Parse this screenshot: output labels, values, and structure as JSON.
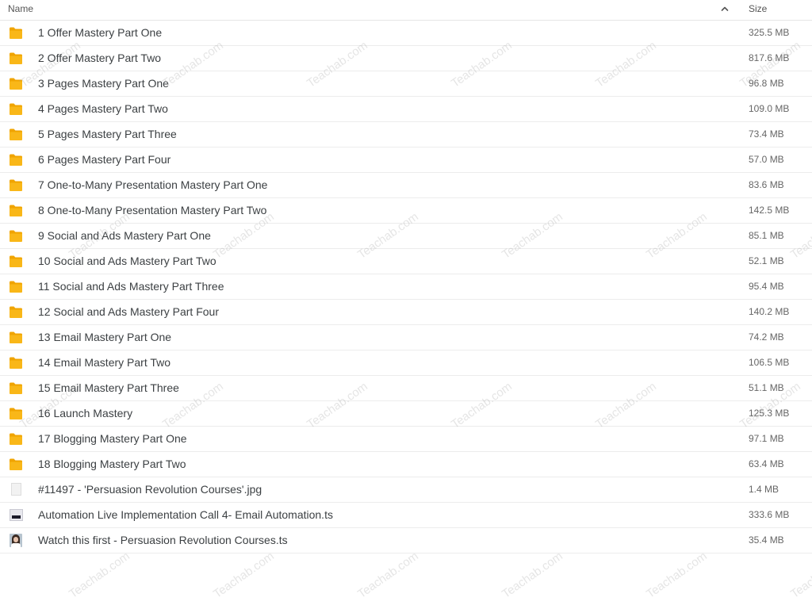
{
  "header": {
    "name_label": "Name",
    "size_label": "Size",
    "sort_icon": "chevron-up-icon"
  },
  "colors": {
    "folder": "#f9b718",
    "folder_dark": "#f0a400",
    "row_border": "#ececec"
  },
  "watermark_text": "Teachab.com",
  "files": [
    {
      "type": "folder",
      "name": "1 Offer Mastery Part One",
      "size": "325.5 MB"
    },
    {
      "type": "folder",
      "name": "2 Offer Mastery Part Two",
      "size": "817.6 MB"
    },
    {
      "type": "folder",
      "name": "3 Pages Mastery Part One",
      "size": "96.8 MB"
    },
    {
      "type": "folder",
      "name": "4 Pages Mastery Part Two",
      "size": "109.0 MB"
    },
    {
      "type": "folder",
      "name": "5 Pages Mastery Part Three",
      "size": "73.4 MB"
    },
    {
      "type": "folder",
      "name": "6 Pages Mastery Part Four",
      "size": "57.0 MB"
    },
    {
      "type": "folder",
      "name": "7 One-to-Many Presentation Mastery Part One",
      "size": "83.6 MB"
    },
    {
      "type": "folder",
      "name": "8 One-to-Many Presentation Mastery Part Two",
      "size": "142.5 MB"
    },
    {
      "type": "folder",
      "name": "9 Social and Ads Mastery Part One",
      "size": "85.1 MB"
    },
    {
      "type": "folder",
      "name": "10 Social and Ads Mastery Part Two",
      "size": "52.1 MB"
    },
    {
      "type": "folder",
      "name": "11 Social and Ads Mastery Part Three",
      "size": "95.4 MB"
    },
    {
      "type": "folder",
      "name": "12 Social and Ads Mastery Part Four",
      "size": "140.2 MB"
    },
    {
      "type": "folder",
      "name": "13 Email Mastery Part One",
      "size": "74.2 MB"
    },
    {
      "type": "folder",
      "name": "14 Email Mastery Part Two",
      "size": "106.5 MB"
    },
    {
      "type": "folder",
      "name": "15 Email Mastery Part Three",
      "size": "51.1 MB"
    },
    {
      "type": "folder",
      "name": "16 Launch Mastery",
      "size": "125.3 MB"
    },
    {
      "type": "folder",
      "name": "17 Blogging Mastery Part One",
      "size": "97.1 MB"
    },
    {
      "type": "folder",
      "name": "18 Blogging Mastery Part Two",
      "size": "63.4 MB"
    },
    {
      "type": "image",
      "name": "#11497 - 'Persuasion Revolution Courses'.jpg",
      "size": "1.4 MB"
    },
    {
      "type": "video",
      "name": "Automation Live Implementation Call 4- Email Automation.ts",
      "size": "333.6 MB"
    },
    {
      "type": "video-person",
      "name": "Watch this first - Persuasion Revolution Courses.ts",
      "size": "35.4 MB"
    }
  ]
}
